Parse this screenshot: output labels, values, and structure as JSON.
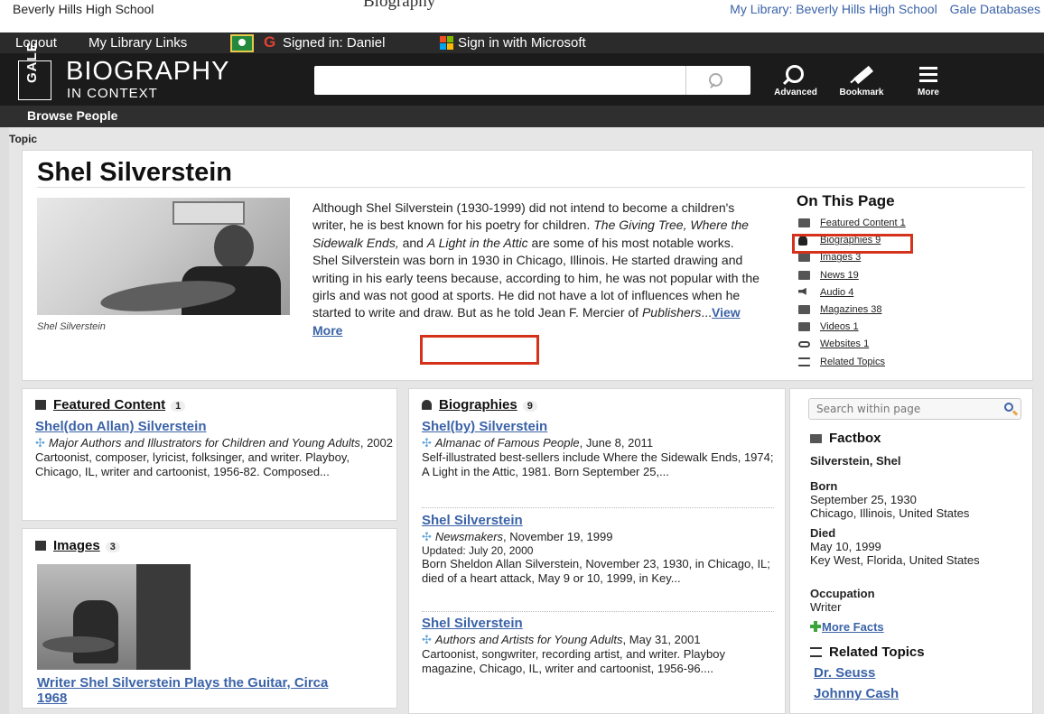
{
  "topbar": {
    "school": "Beverly Hills High School",
    "window_title": "Biography",
    "my_library_link": "My Library: Beverly Hills High School",
    "gale_databases_link": "Gale Databases"
  },
  "utilbar": {
    "logout": "Logout",
    "my_library_links": "My Library Links",
    "signed_in": "Signed in: Daniel",
    "sign_in_microsoft": "Sign in with Microsoft"
  },
  "header": {
    "logo_text": "GALE",
    "brand_title": "BIOGRAPHY",
    "brand_subtitle": "IN CONTEXT",
    "search_value": "",
    "advanced_label": "Advanced",
    "bookmark_label": "Bookmark",
    "more_label": "More"
  },
  "browsebar": {
    "browse_people": "Browse People"
  },
  "breadcrumb": "Topic",
  "topic": {
    "title": "Shel Silverstein",
    "photo_caption": "Shel Silverstein",
    "bio_1": "Although Shel Silverstein (1930-1999) did not intend to become a children's writer, he is best known for his poetry for children. ",
    "bio_italic_1": "The Giving Tree, Where the Sidewalk Ends,",
    "bio_2": " and ",
    "bio_italic_2": "A Light in the Attic",
    "bio_3": " are some of his most notable works. Shel Silverstein was born in 1930 in Chicago, Illinois. He started drawing and writing in his early teens because, according to him, he was not popular with the girls and was not good at sports. He did not have a lot of influences when he started to write and draw. But as he told Jean F. Mercier of ",
    "bio_italic_3": "Publishers",
    "bio_4": "...",
    "view_more": "View More"
  },
  "on_this_page": {
    "heading": "On This Page",
    "items": [
      {
        "label": "Featured Content 1",
        "icon": "featured-icon"
      },
      {
        "label": "Biographies 9",
        "icon": "person-icon"
      },
      {
        "label": "Images 3",
        "icon": "image-icon"
      },
      {
        "label": "News 19",
        "icon": "news-icon"
      },
      {
        "label": "Audio 4",
        "icon": "audio-icon"
      },
      {
        "label": "Magazines 38",
        "icon": "magazine-icon"
      },
      {
        "label": "Videos 1",
        "icon": "video-icon"
      },
      {
        "label": "Websites 1",
        "icon": "link-icon"
      },
      {
        "label": "Related Topics",
        "icon": "related-topics-icon"
      }
    ]
  },
  "featured": {
    "title": "Featured Content",
    "count": "1",
    "entry": {
      "title": "Shel(don Allan) Silverstein",
      "source_italic": "Major Authors and Illustrators for Children and Young Adults",
      "source_rest": ", 2002",
      "desc": "Cartoonist, composer, lyricist, folksinger, and writer. Playboy, Chicago, IL, writer and cartoonist, 1956-82. Composed..."
    }
  },
  "images": {
    "title": "Images",
    "count": "3",
    "caption": "Writer Shel Silverstein Plays the Guitar, Circa 1968"
  },
  "biographies": {
    "title": "Biographies",
    "count": "9",
    "entries": [
      {
        "title": "Shel(by) Silverstein",
        "source_italic": "Almanac of Famous People",
        "source_rest": ", June 8, 2011",
        "updated": "",
        "desc": "Self-illustrated best-sellers include Where the Sidewalk Ends, 1974; A Light in the Attic, 1981. Born September 25,..."
      },
      {
        "title": "Shel Silverstein",
        "source_italic": "Newsmakers",
        "source_rest": ", November 19, 1999",
        "updated": "Updated: July 20, 2000",
        "desc": "Born Sheldon Allan Silverstein, November 23, 1930, in Chicago, IL; died of a heart attack, May 9 or 10, 1999, in Key..."
      },
      {
        "title": "Shel Silverstein",
        "source_italic": "Authors and Artists for Young Adults",
        "source_rest": ", May 31, 2001",
        "updated": "",
        "desc": "Cartoonist, songwriter, recording artist, and writer. Playboy magazine, Chicago, IL, writer and cartoonist, 1956-96...."
      }
    ]
  },
  "sidebar": {
    "search_placeholder": "Search within page",
    "factbox_title": "Factbox",
    "name": "Silverstein, Shel",
    "born_label": "Born",
    "born_date": "September 25, 1930",
    "born_place": "Chicago, Illinois, United States",
    "died_label": "Died",
    "died_date": "May 10, 1999",
    "died_place": "Key West, Florida, United States",
    "occupation_label": "Occupation",
    "occupation": "Writer",
    "more_facts": "More Facts",
    "related_title": "Related Topics",
    "related": [
      "Dr. Seuss",
      "Johnny Cash"
    ]
  },
  "colors": {
    "link_blue": "#3b63a8",
    "highlight_red": "#d5321b",
    "header_black": "#1b1b1b"
  }
}
